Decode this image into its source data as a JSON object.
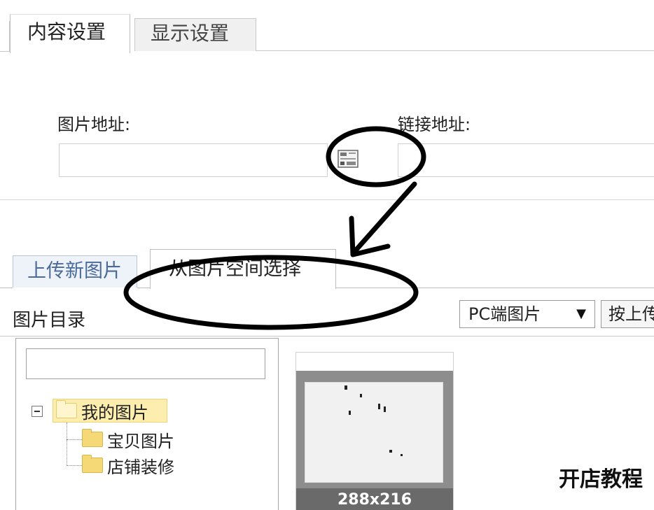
{
  "top_tabs": {
    "content": "内容设置",
    "display": "显示设置"
  },
  "fields": {
    "image_url_label": "图片地址:",
    "link_url_label": "链接地址:",
    "image_url_value": "",
    "link_url_value": ""
  },
  "lower_tabs": {
    "upload": "上传新图片",
    "from_space": "从图片空间选择"
  },
  "directory": {
    "title": "图片目录",
    "search_value": ""
  },
  "toolbar": {
    "source_select": "PC端图片",
    "sort_button": "按上传"
  },
  "tree": {
    "root": "我的图片",
    "children": [
      "宝贝图片",
      "店铺装修"
    ]
  },
  "thumbnail": {
    "caption": "288x216"
  },
  "watermark": "开店教程",
  "colors": {
    "tree_highlight": "#fdeeb0",
    "folder": "#f6d977",
    "annotation": "#000000"
  },
  "icons": {
    "image_picker": "image-picker-icon",
    "collapse": "minus-box-icon",
    "folder": "folder-icon",
    "dropdown": "triangle-down-icon"
  }
}
